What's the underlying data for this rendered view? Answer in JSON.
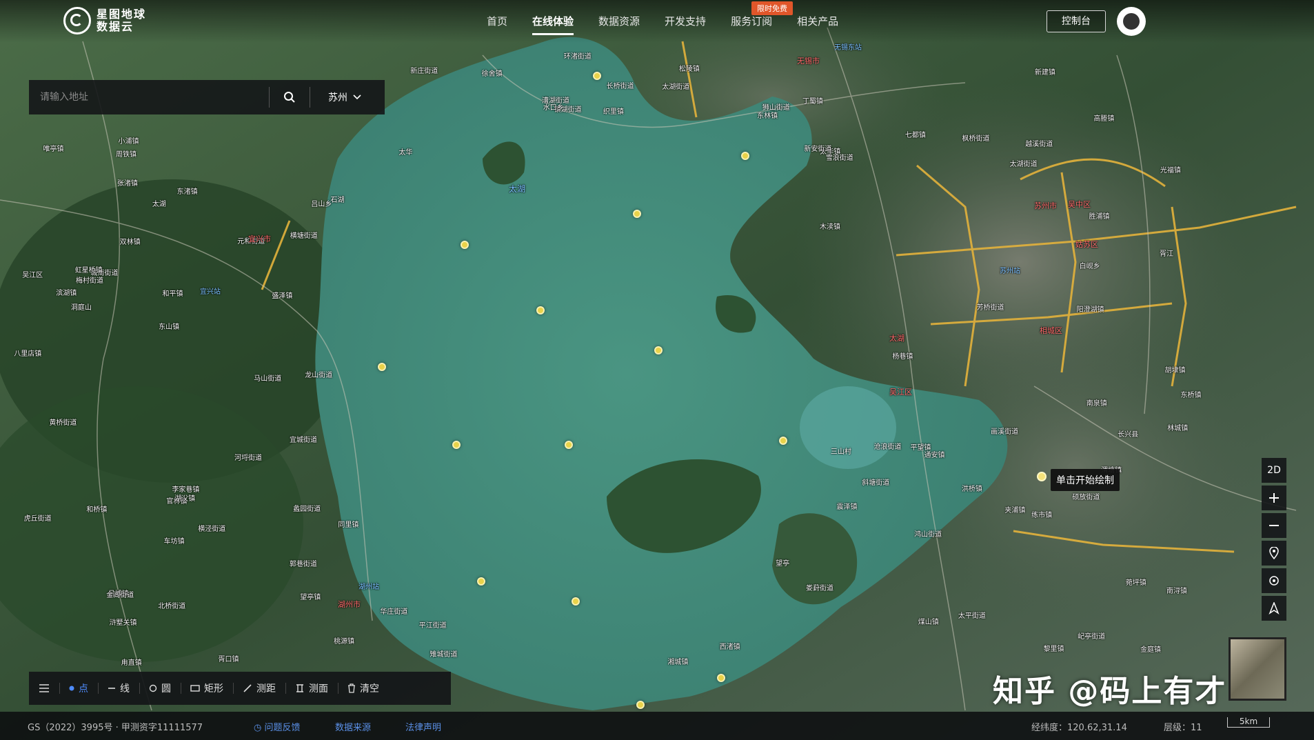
{
  "nav": {
    "promo": "限时免费",
    "items": [
      "首页",
      "在线体验",
      "数据资源",
      "开发支持",
      "服务订阅",
      "相关产品"
    ],
    "console": "控制台"
  },
  "logo": {
    "line1": "星图地球",
    "line2": "数据云"
  },
  "search": {
    "placeholder": "请输入地址",
    "city": "苏州"
  },
  "map": {
    "lake_label": "太湖",
    "tooltip": "单击开始绘制",
    "mode_2d": "2D",
    "places_white": [
      "太湖",
      "吕城镇",
      "丁蜀镇",
      "太华镇",
      "金庭镇",
      "东山镇",
      "光福镇",
      "木渎镇",
      "胥口镇",
      "横泾街道",
      "浒墅关镇",
      "望亭镇",
      "通安镇",
      "东渚镇",
      "镇湖街道",
      "洞庭山",
      "三山村",
      "胥江",
      "石湖",
      "七都镇",
      "同里镇",
      "黎里镇",
      "菀坪镇",
      "平望镇",
      "松陵镇",
      "盛泽镇",
      "震泽镇",
      "桃源镇",
      "吴江区",
      "甪直镇",
      "车坊镇",
      "胜浦镇",
      "唯亭镇",
      "斜塘街道",
      "娄葑街道",
      "郭巷街道",
      "越溪街道",
      "长桥街道",
      "城南街道",
      "横塘街道",
      "枫桥街道",
      "狮山街道",
      "虎丘街道",
      "平江街道",
      "沧浪街道",
      "金阊街道",
      "元和街道",
      "黄桥街道",
      "北桥街道",
      "渭塘镇",
      "阳澄湖镇",
      "太平街道",
      "湘城镇",
      "望亭",
      "漕湖街道",
      "东桥镇",
      "鸿山街道",
      "硕放街道",
      "梅村街道",
      "新安街道",
      "雪浪街道",
      "马山街道",
      "胡埭镇",
      "滨湖镇",
      "河埒街道",
      "蠡园街道",
      "华庄街道",
      "太湖街道",
      "南泉镇",
      "周铁镇",
      "新庄街道",
      "和桥镇",
      "高塍镇",
      "徐舍镇",
      "官林镇",
      "新建镇",
      "杨巷镇",
      "宜城街道",
      "屺亭街道",
      "芳桥街道",
      "张渚镇",
      "湖㳇镇",
      "西渚镇",
      "太华",
      "长兴县",
      "洪桥镇",
      "李家巷镇",
      "林城镇",
      "和平镇",
      "夹浦镇",
      "小浦镇",
      "煤山镇",
      "水口乡",
      "白岘乡",
      "吕山乡",
      "虹星桥镇",
      "雉城街道",
      "画溪街道",
      "太湖街道",
      "龙山街道",
      "织里镇",
      "八里店镇",
      "环渚街道",
      "东林镇",
      "双林镇",
      "南浔镇",
      "练市镇"
    ],
    "places_red": [
      "宜兴市",
      "太湖",
      "吴中区",
      "姑苏区",
      "苏州市",
      "相城区",
      "无锡市",
      "湖州市",
      "吴江区"
    ],
    "places_blue": [
      "宜兴站",
      "苏州站",
      "无锡东站",
      "湖州站"
    ]
  },
  "drawbar": {
    "items": [
      {
        "icon": "list-icon",
        "label": ""
      },
      {
        "icon": "point-icon",
        "label": "点"
      },
      {
        "icon": "line-icon",
        "label": "线"
      },
      {
        "icon": "circle-icon",
        "label": "圆"
      },
      {
        "icon": "rect-icon",
        "label": "矩形"
      },
      {
        "icon": "ruler-icon",
        "label": "测距"
      },
      {
        "icon": "area-icon",
        "label": "测面"
      },
      {
        "icon": "trash-icon",
        "label": "清空"
      }
    ]
  },
  "footer": {
    "copyright": "GS（2022）3995号 · 甲测资字11111577",
    "feedback": "问题反馈",
    "data_source": "数据来源",
    "law": "法律声明",
    "coord_label": "经纬度：",
    "coord_value": "120.62,31.14",
    "level_label": "层级：",
    "level_value": "11",
    "scale": "5km"
  },
  "watermark": "知乎 @码上有才",
  "colors": {
    "lake": "#3f8c7b",
    "land": "#3b5a3d",
    "road": "#e3b23c",
    "poi": "#e9d24a",
    "accent": "#4e8cff"
  }
}
